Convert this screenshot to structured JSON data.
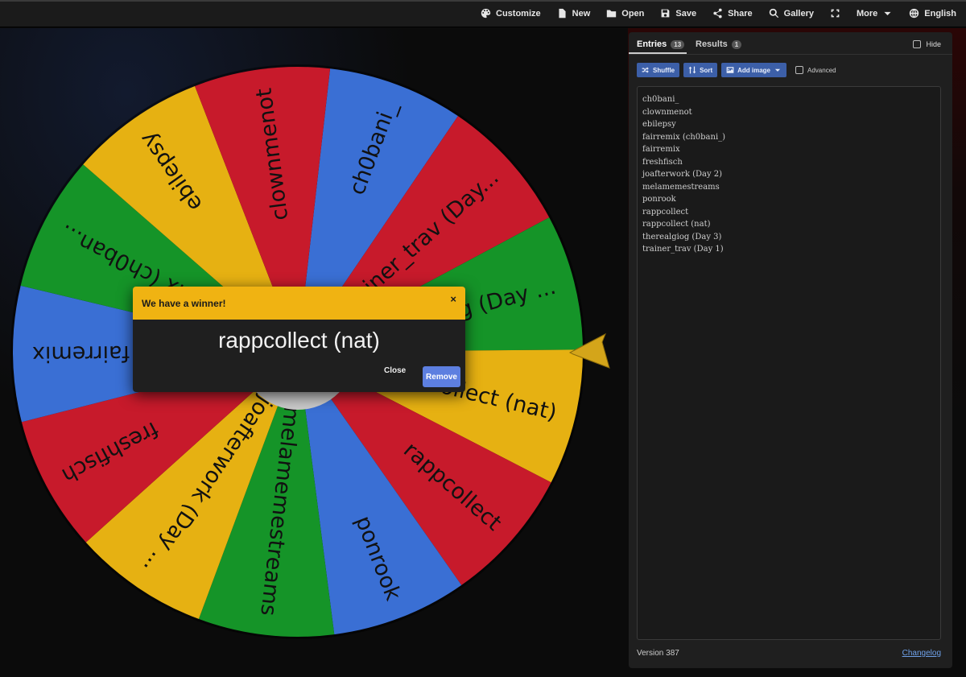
{
  "toolbar": {
    "items": [
      {
        "label": "Customize",
        "icon": "palette-icon"
      },
      {
        "label": "New",
        "icon": "file-icon"
      },
      {
        "label": "Open",
        "icon": "folder-icon"
      },
      {
        "label": "Save",
        "icon": "save-icon"
      },
      {
        "label": "Share",
        "icon": "share-icon"
      },
      {
        "label": "Gallery",
        "icon": "search-icon"
      },
      {
        "label": "",
        "icon": "fullscreen-icon"
      },
      {
        "label": "More",
        "icon": "chevron-down-icon"
      },
      {
        "label": "English",
        "icon": "globe-icon"
      }
    ]
  },
  "wheel": {
    "segments": [
      {
        "label": "ch0bani_",
        "color": "#3a6fd4"
      },
      {
        "label": "trainer_trav (Day...",
        "color": "#c71a2b"
      },
      {
        "label": "therealgiog (Day ...",
        "color": "#159428"
      },
      {
        "label": "rappcollect (nat)",
        "color": "#e6b112"
      },
      {
        "label": "rappcollect",
        "color": "#c71a2b"
      },
      {
        "label": "ponrook",
        "color": "#3a6fd4"
      },
      {
        "label": "melamemestreams",
        "color": "#159428"
      },
      {
        "label": "joafterwork (Day ...",
        "color": "#e6b112"
      },
      {
        "label": "freshfisch",
        "color": "#c71a2b"
      },
      {
        "label": "fairremix",
        "color": "#3a6fd4"
      },
      {
        "label": "fairremix (ch0ban...",
        "color": "#159428"
      },
      {
        "label": "ebilepsy",
        "color": "#e6b112"
      },
      {
        "label": "clownmenot",
        "color": "#c71a2b"
      }
    ],
    "pointer_color": "#d4a51a"
  },
  "panel": {
    "tab_entries": "Entries",
    "tab_entries_count": "13",
    "tab_results": "Results",
    "tab_results_count": "1",
    "hide_label": "Hide",
    "shuffle_label": "Shuffle",
    "sort_label": "Sort",
    "add_image_label": "Add image",
    "advanced_label": "Advanced",
    "entries": [
      "ch0bani_",
      "clownmenot",
      "ebilepsy",
      "fairremix (ch0bani_)",
      "fairremix",
      "freshfisch",
      "joafterwork (Day 2)",
      "melamemestreams",
      "ponrook",
      "rappcollect",
      "rappcollect (nat)",
      "therealgiog (Day 3)",
      "trainer_trav (Day 1)"
    ],
    "version": "Version 387",
    "changelog": "Changelog"
  },
  "dialog": {
    "title": "We have a winner!",
    "close_x": "×",
    "winner": "rappcollect (nat)",
    "close_label": "Close",
    "remove_label": "Remove",
    "header_color": "#f0b312"
  }
}
